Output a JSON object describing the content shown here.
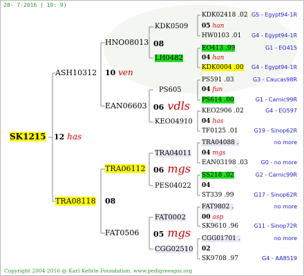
{
  "header": {
    "date": "28-  7-2016 ( 19:  9)"
  },
  "footer": {
    "copyright": "Copyright 2004-2016 @ Karl Kehrle Foundation.   www.pedigreeapis.org"
  },
  "root": {
    "code": "SK1215",
    "num": "12",
    "q": "has"
  },
  "gen2": [
    {
      "code": "ASH10312",
      "num": "10",
      "q": "ven"
    },
    {
      "code": "TRA08118",
      "num": "08",
      "q": ""
    }
  ],
  "gen3": [
    {
      "code": "HNO08013",
      "num": "08",
      "q": ""
    },
    {
      "code": "EAN06603",
      "num": "06",
      "q": "vdls"
    },
    {
      "code": "TRA06112",
      "num": "06",
      "q": "mgs"
    },
    {
      "code": "FAT0506",
      "num": "05",
      "q": "mgs"
    }
  ],
  "gen4": [
    {
      "code": "KDK0509",
      "num": "05",
      "q": "han"
    },
    {
      "code": "LH0482",
      "num": "04",
      "q": "han"
    },
    {
      "code": "PS605",
      "num": "04",
      "q": "fun"
    },
    {
      "code": "KEO04910",
      "num": "04",
      "q": "has"
    },
    {
      "code": "TRA04011",
      "num": "04",
      "q": "mgs"
    },
    {
      "code": "PES04022",
      "num": "04",
      "q": ""
    },
    {
      "code": "FAT0002",
      "num": "00",
      "q": "asp"
    },
    {
      "code": "CGG02510",
      "num": "02",
      "q": ""
    }
  ],
  "gen5": [
    {
      "code": "KDK02418 .02",
      "tag": "G5 - Egypt94-1R"
    },
    {
      "code": "HW0103 .01",
      "tag": "G4 - Egypt94-1R"
    },
    {
      "code": "EO413 .99",
      "tag": "G1 - EO415"
    },
    {
      "code": "KDK0004 .00",
      "tag": "G4 - Egypt94-1R"
    },
    {
      "code": "PS591 .03",
      "tag": "G3 - Caucas98R"
    },
    {
      "code": "PS614 .00",
      "tag": "G1 - Carnic99R"
    },
    {
      "code": "KEO2906 .02",
      "tag": "G4 - EO597"
    },
    {
      "code": "TF0125 .01",
      "tag": "G19 - Sinop62R"
    },
    {
      "code": "TRA04088 .",
      "tag": "no more"
    },
    {
      "code": "EAN03198 .03",
      "tag": "G0 - no more"
    },
    {
      "code": "SS218 .02",
      "tag": "G2 - Carnic99R"
    },
    {
      "code": "ST339 .99",
      "tag": "G17 - Sinop62R"
    },
    {
      "code": "FAT9802 .",
      "tag": "no more"
    },
    {
      "code": "SK9610 .96",
      "tag": "G11 - Sinop72R"
    },
    {
      "code": "CGG01701 .",
      "tag": "no more"
    },
    {
      "code": "SK9708 .97",
      "tag": "G4 - AA8519"
    }
  ]
}
